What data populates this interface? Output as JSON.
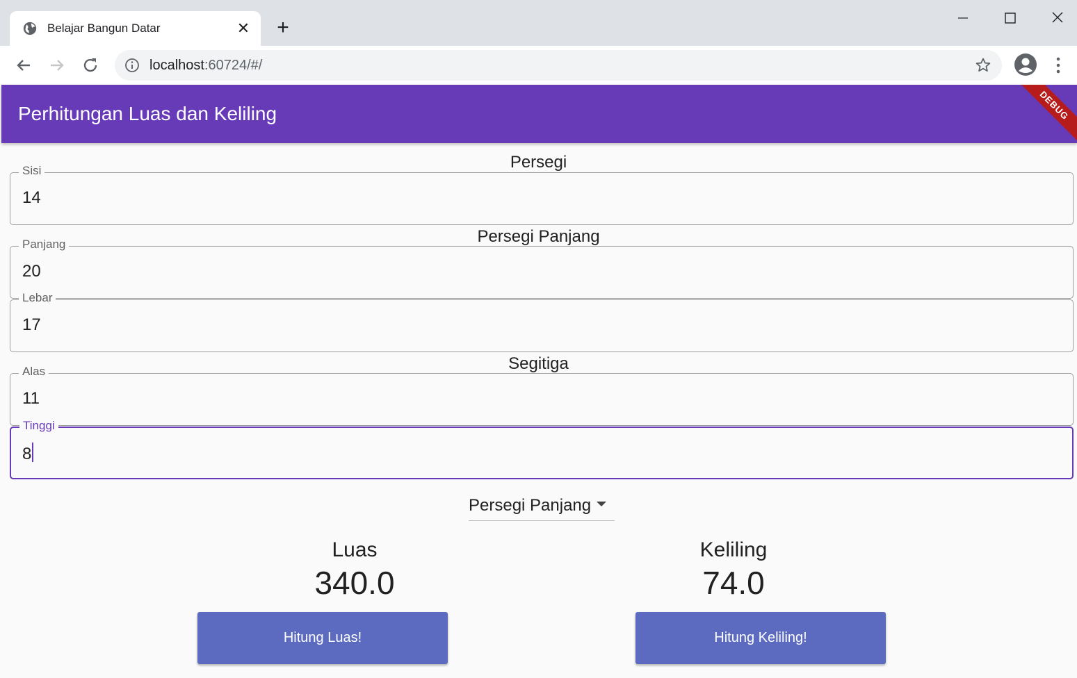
{
  "browser": {
    "tab_title": "Belajar Bangun Datar",
    "url_host": "localhost",
    "url_rest": ":60724/#/"
  },
  "app": {
    "title": "Perhitungan Luas dan Keliling",
    "debug_banner": "DEBUG",
    "accent_color": "#673ab7",
    "button_color": "#5c6bc0"
  },
  "sections": {
    "square": {
      "heading": "Persegi",
      "side": {
        "label": "Sisi",
        "value": "14"
      }
    },
    "rectangle": {
      "heading": "Persegi Panjang",
      "length": {
        "label": "Panjang",
        "value": "20"
      },
      "width": {
        "label": "Lebar",
        "value": "17"
      }
    },
    "triangle": {
      "heading": "Segitiga",
      "base": {
        "label": "Alas",
        "value": "11"
      },
      "height": {
        "label": "Tinggi",
        "value": "8"
      }
    }
  },
  "shape_select": {
    "selected": "Persegi Panjang"
  },
  "results": {
    "area": {
      "label": "Luas",
      "value": "340.0"
    },
    "perimeter": {
      "label": "Keliling",
      "value": "74.0"
    }
  },
  "buttons": {
    "area": "Hitung Luas!",
    "perimeter": "Hitung Keliling!"
  }
}
